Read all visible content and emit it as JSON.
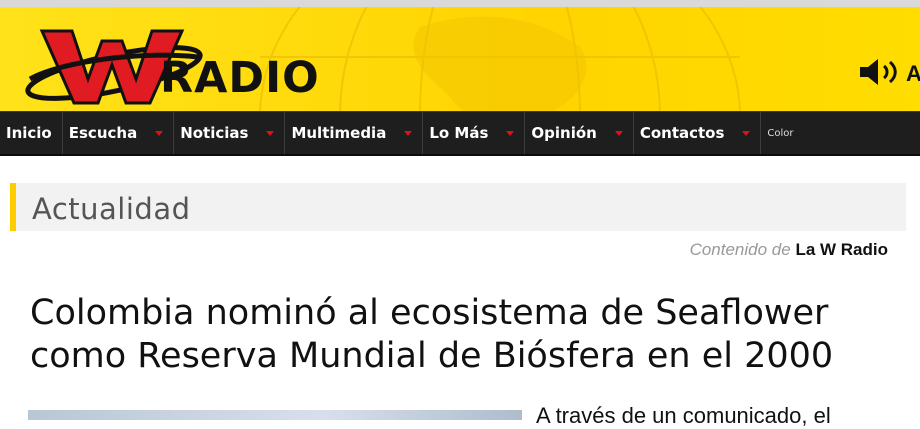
{
  "brand": {
    "logo_letter": "W",
    "logo_word": "RADIO",
    "colors": {
      "header_yellow": "#ffdd00",
      "logo_red": "#e11b22",
      "nav_bg": "#1e1e1e",
      "caret_red": "#e0101a"
    }
  },
  "header": {
    "speaker_icon": "speaker-icon",
    "cut_text": "A"
  },
  "nav": {
    "items": [
      {
        "label": "Inicio"
      },
      {
        "label": "Escucha"
      },
      {
        "label": "Noticias"
      },
      {
        "label": "Multimedia"
      },
      {
        "label": "Lo Más"
      },
      {
        "label": "Opinión"
      },
      {
        "label": "Contactos"
      }
    ],
    "trailing": "Color"
  },
  "section": {
    "title": "Actualidad"
  },
  "credit": {
    "prefix": "Contenido de",
    "brand": "La W Radio"
  },
  "article": {
    "headline_line1": "Colombia nominó al ecosistema de Seaflower",
    "headline_line2": "como Reserva Mundial de Biósfera en el 2000",
    "lead_snippet": "A través de un comunicado, el"
  }
}
